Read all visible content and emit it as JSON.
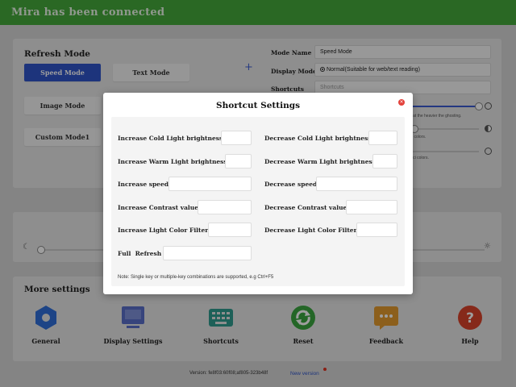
{
  "banner": {
    "text": "Mira has been connected"
  },
  "refresh": {
    "title": "Refresh Mode",
    "add": "+",
    "modes": [
      "Speed Mode",
      "Text Mode",
      "Image Mode",
      "Custom Mode1"
    ],
    "mode_name_label": "Mode Name",
    "mode_name_value": "Speed Mode",
    "display_mode_label": "Display Mode",
    "display_mode_value": "Normal(Suitable for web/text reading)",
    "shortcuts_label": "Shortcuts",
    "shortcuts_placeholder": "Shortcuts",
    "hint1": "lat the heavier the ghosting.",
    "hint2": "l colors.",
    "hint3": "ici colors."
  },
  "more": {
    "title": "More settings",
    "items": [
      "General",
      "Display Settings",
      "Shortcuts",
      "Reset",
      "Feedback",
      "Help"
    ]
  },
  "footer": {
    "version": "Version: fe8f03:60f08;af805-323b48f",
    "new_version": "New version"
  },
  "modal": {
    "title": "Shortcut Settings",
    "close": "×",
    "labels": {
      "inc_cold": "Increase Cold Light brightness",
      "dec_cold": "Decrease Cold Light brightness",
      "inc_warm": "Increase Warm Light brightness",
      "dec_warm": "Decrease Warm Light brightness",
      "inc_speed": "Increase speed",
      "dec_speed": "Decrease speed",
      "inc_contrast": "Increase Contrast value",
      "dec_contrast": "Decrease Contrast value",
      "inc_filter": "Increase Light Color Filter",
      "dec_filter": "Decrease Light Color Filter",
      "full_refresh": "Full  Refresh"
    },
    "note": "Note: Single key or multiple-key combinations are supported, e.g Ctrl+F5"
  },
  "colors": {
    "banner": "#45a93b",
    "accent": "#2f54c8",
    "close": "#e3413b"
  },
  "icons": {
    "add": "plus-icon",
    "general": "hexagon-gear-icon",
    "display": "monitor-icon",
    "shortcuts": "keyboard-icon",
    "reset": "refresh-icon",
    "feedback": "chat-icon",
    "help": "question-icon"
  }
}
